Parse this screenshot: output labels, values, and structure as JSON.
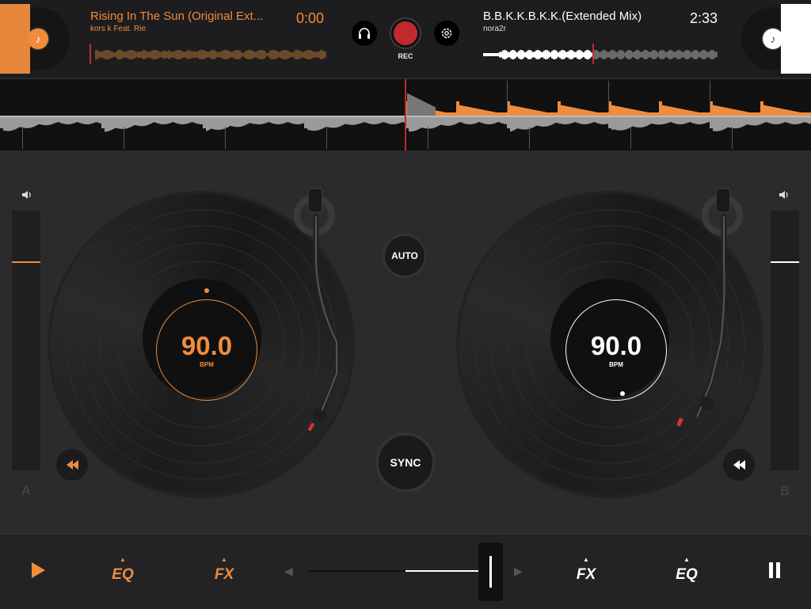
{
  "deck_a": {
    "title": "Rising In The Sun (Original Ext...",
    "artist": "kors k Feat. Rie",
    "time": "0:00",
    "bpm": "90.0",
    "bpm_label": "BPM",
    "side_label": "A",
    "volume_level": 0.8,
    "album_icon": "music-note-icon"
  },
  "deck_b": {
    "title": "B.B.K.K.B.K.K.(Extended Mix)",
    "artist": "nora2r",
    "time": "2:33",
    "bpm": "90.0",
    "bpm_label": "BPM",
    "side_label": "B",
    "volume_level": 0.8,
    "album_icon": "music-note-icon"
  },
  "center": {
    "rec_label": "REC",
    "auto_label": "AUTO",
    "sync_label": "SYNC"
  },
  "bottom": {
    "eq_left": "EQ",
    "fx_left": "FX",
    "fx_right": "FX",
    "eq_right": "EQ",
    "crossfader_position": 0.5
  },
  "colors": {
    "accent_a": "#f08c3c",
    "accent_b": "#ffffff",
    "rec": "#c0292e",
    "background": "#2b2b2d"
  }
}
